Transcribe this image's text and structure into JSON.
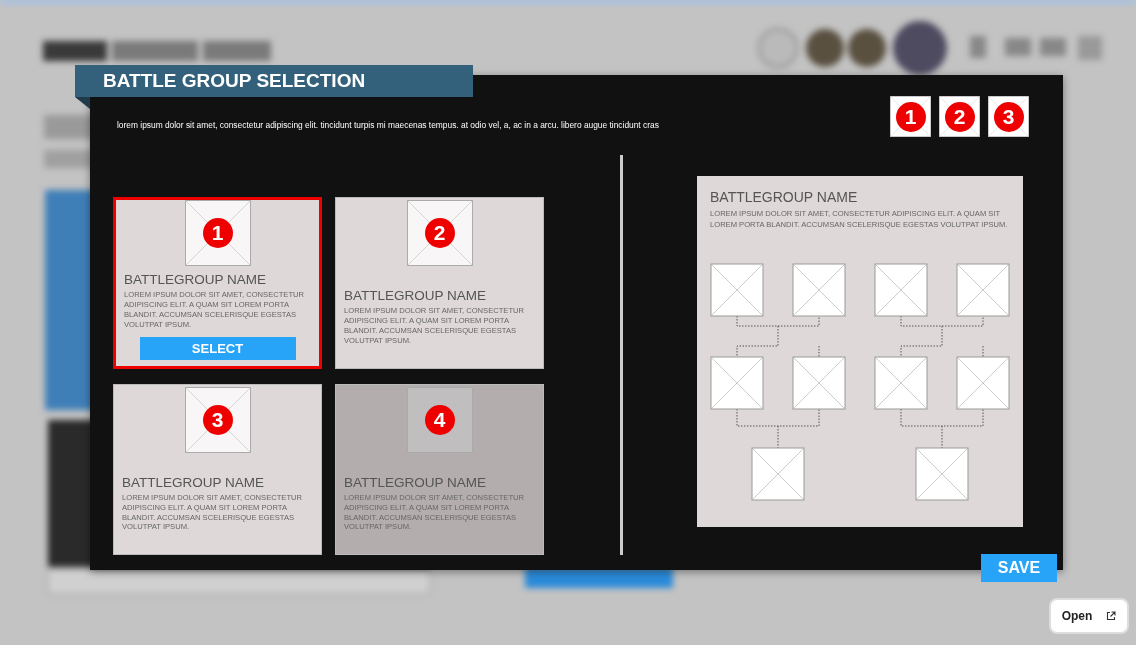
{
  "dialog": {
    "title": "BATTLE GROUP SELECTION",
    "description": "lorem ipsum dolor sit amet, consectetur adipiscing elit. tincidunt turpis mi maecenas tempus. at odio vel, a, ac in a arcu. libero augue tincidunt cras",
    "step_badges": [
      "1",
      "2",
      "3"
    ],
    "cards": [
      {
        "number": "1",
        "name": "BATTLEGROUP NAME",
        "description": "LOREM IPSUM DOLOR SIT AMET, CONSECTETUR ADIPISCING ELIT. A QUAM SIT LOREM PORTA BLANDIT. ACCUMSAN SCELERISQUE EGESTAS VOLUTPAT IPSUM.",
        "selected": true,
        "disabled": false,
        "action": "SELECT"
      },
      {
        "number": "2",
        "name": "BATTLEGROUP NAME",
        "description": "LOREM IPSUM DOLOR SIT AMET, CONSECTETUR ADIPISCING ELIT. A QUAM SIT LOREM PORTA BLANDIT. ACCUMSAN SCELERISQUE EGESTAS VOLUTPAT IPSUM.",
        "selected": false,
        "disabled": false
      },
      {
        "number": "3",
        "name": "BATTLEGROUP NAME",
        "description": "LOREM IPSUM DOLOR SIT AMET, CONSECTETUR ADIPISCING ELIT. A QUAM SIT LOREM PORTA BLANDIT. ACCUMSAN SCELERISQUE EGESTAS VOLUTPAT IPSUM.",
        "selected": false,
        "disabled": false
      },
      {
        "number": "4",
        "name": "BATTLEGROUP NAME",
        "description": "LOREM IPSUM DOLOR SIT AMET, CONSECTETUR ADIPISCING ELIT. A QUAM SIT LOREM PORTA BLANDIT. ACCUMSAN SCELERISQUE EGESTAS VOLUTPAT IPSUM.",
        "selected": false,
        "disabled": true
      }
    ],
    "detail": {
      "name": "BATTLEGROUP NAME",
      "description": "LOREM IPSUM DOLOR SIT AMET, CONSECTETUR ADIPISCING ELIT. A QUAM SIT LOREM PORTA BLANDIT. ACCUMSAN SCELERISQUE EGESTAS VOLUTPAT IPSUM."
    },
    "save_label": "SAVE"
  },
  "open_button": {
    "label": "Open"
  }
}
